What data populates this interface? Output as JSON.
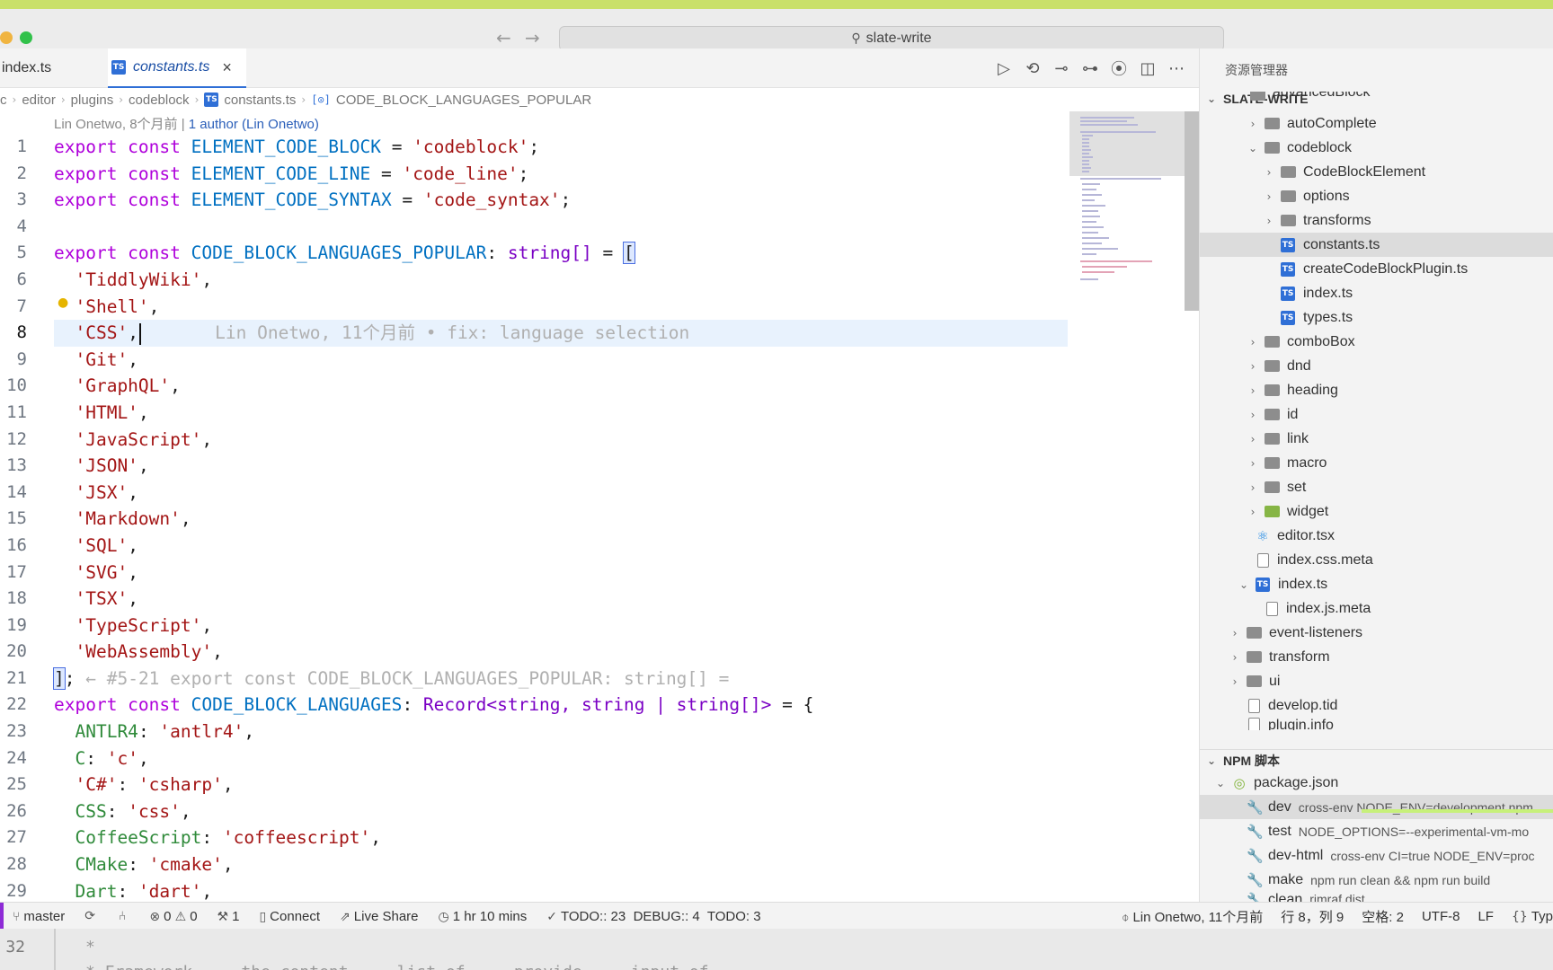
{
  "window": {
    "search_text": "slate-write"
  },
  "tabs": [
    {
      "label": "index.ts",
      "active": false
    },
    {
      "label": "constants.ts",
      "active": true,
      "close": "×"
    }
  ],
  "breadcrumb": [
    "c",
    "editor",
    "plugins",
    "codeblock",
    "constants.ts",
    "CODE_BLOCK_LANGUAGES_POPULAR"
  ],
  "blame_header": {
    "text": "Lin Onetwo, 8个月前 |",
    "link": "1 author (Lin Onetwo)"
  },
  "inline_blame": "Lin Onetwo, 11个月前 • fix: language selection",
  "code_lines": [
    {
      "n": "1"
    },
    {
      "n": "2"
    },
    {
      "n": "3"
    },
    {
      "n": "4"
    },
    {
      "n": "5"
    },
    {
      "n": "6"
    },
    {
      "n": "7"
    },
    {
      "n": "8"
    },
    {
      "n": "9"
    },
    {
      "n": "10"
    },
    {
      "n": "11"
    },
    {
      "n": "12"
    },
    {
      "n": "13"
    },
    {
      "n": "14"
    },
    {
      "n": "15"
    },
    {
      "n": "16"
    },
    {
      "n": "17"
    },
    {
      "n": "18"
    },
    {
      "n": "19"
    },
    {
      "n": "20"
    },
    {
      "n": "21"
    },
    {
      "n": "22"
    },
    {
      "n": "23"
    },
    {
      "n": "24"
    },
    {
      "n": "25"
    },
    {
      "n": "26"
    },
    {
      "n": "27"
    },
    {
      "n": "28"
    },
    {
      "n": "29"
    }
  ],
  "code": {
    "l1": {
      "kw": "export const ",
      "name": "ELEMENT_CODE_BLOCK",
      "eq": " = ",
      "str": "'codeblock'",
      "end": ";"
    },
    "l2": {
      "kw": "export const ",
      "name": "ELEMENT_CODE_LINE",
      "eq": " = ",
      "str": "'code_line'",
      "end": ";"
    },
    "l3": {
      "kw": "export const ",
      "name": "ELEMENT_CODE_SYNTAX",
      "eq": " = ",
      "str": "'code_syntax'",
      "end": ";"
    },
    "l5": {
      "kw": "export const ",
      "name": "CODE_BLOCK_LANGUAGES_POPULAR",
      "colon": ": ",
      "type": "string[]",
      "eq": " = ",
      "bracket": "["
    },
    "popular": [
      "'TiddlyWiki'",
      "'Shell'",
      "'CSS'",
      "'Git'",
      "'GraphQL'",
      "'HTML'",
      "'JavaScript'",
      "'JSON'",
      "'JSX'",
      "'Markdown'",
      "'SQL'",
      "'SVG'",
      "'TSX'",
      "'TypeScript'",
      "'WebAssembly'"
    ],
    "comma": ",",
    "l21": {
      "bracket": "]",
      "semi": ";",
      "hint": " ← #5-21 export const CODE_BLOCK_LANGUAGES_POPULAR: string[] ="
    },
    "l22": {
      "kw": "export const ",
      "name": "CODE_BLOCK_LANGUAGES",
      "colon": ": ",
      "type": "Record<string, string | string[]>",
      "eq": " = {"
    },
    "l23": {
      "key": "ANTLR4",
      "sep": ": ",
      "val": "'antlr4'",
      "end": ","
    },
    "l24": {
      "key": "C",
      "sep": ": ",
      "val": "'c'",
      "end": ","
    },
    "l25": {
      "key": "'C#'",
      "sep": ": ",
      "val": "'csharp'",
      "end": ","
    },
    "l26": {
      "key": "CSS",
      "sep": ": ",
      "val": "'css'",
      "end": ","
    },
    "l27": {
      "key": "CoffeeScript",
      "sep": ": ",
      "val": "'coffeescript'",
      "end": ","
    },
    "l28": {
      "key": "CMake",
      "sep": ": ",
      "val": "'cmake'",
      "end": ","
    },
    "l29": {
      "key": "Dart",
      "sep": ": ",
      "val": "'dart'",
      "end": ","
    }
  },
  "explorer": {
    "title": "资源管理器",
    "root": "SLATE-WRITE",
    "items": [
      {
        "label": "advancedBlock"
      },
      {
        "label": "autoComplete"
      },
      {
        "label": "codeblock"
      },
      {
        "label": "CodeBlockElement"
      },
      {
        "label": "options"
      },
      {
        "label": "transforms"
      },
      {
        "label": "constants.ts"
      },
      {
        "label": "createCodeBlockPlugin.ts"
      },
      {
        "label": "index.ts"
      },
      {
        "label": "types.ts"
      },
      {
        "label": "comboBox"
      },
      {
        "label": "dnd"
      },
      {
        "label": "heading"
      },
      {
        "label": "id"
      },
      {
        "label": "link"
      },
      {
        "label": "macro"
      },
      {
        "label": "set"
      },
      {
        "label": "widget"
      },
      {
        "label": "editor.tsx"
      },
      {
        "label": "index.css.meta"
      },
      {
        "label": "index.ts"
      },
      {
        "label": "index.js.meta"
      },
      {
        "label": "event-listeners"
      },
      {
        "label": "transform"
      },
      {
        "label": "ui"
      },
      {
        "label": "develop.tid"
      },
      {
        "label": "plugin.info"
      }
    ]
  },
  "npm": {
    "title": "NPM 脚本",
    "package": "package.json",
    "scripts": [
      {
        "name": "dev",
        "cmd": "cross-env NODE_ENV=development npm"
      },
      {
        "name": "test",
        "cmd": "NODE_OPTIONS=--experimental-vm-mo"
      },
      {
        "name": "dev-html",
        "cmd": "cross-env CI=true NODE_ENV=proc"
      },
      {
        "name": "make",
        "cmd": "npm run clean && npm run build"
      },
      {
        "name": "clean",
        "cmd": "rimraf dist"
      }
    ]
  },
  "status": {
    "branch": "master",
    "errors": "0",
    "warnings": "0",
    "ports": "1",
    "connect": "Connect",
    "live_share": "Live Share",
    "time": "1 hr 10 mins",
    "todo": "TODO:: 23  DEBUG:: 4  TODO: 3",
    "blame": "Lin Onetwo, 11个月前",
    "position": "行 8，列 9",
    "spaces": "空格: 2",
    "encoding": "UTF-8",
    "eol": "LF",
    "lang": "Typ"
  },
  "terminal": {
    "line_no": "32",
    "line1": "*",
    "line2": "* Framework ... the content ... list of ... provide ... input of"
  }
}
